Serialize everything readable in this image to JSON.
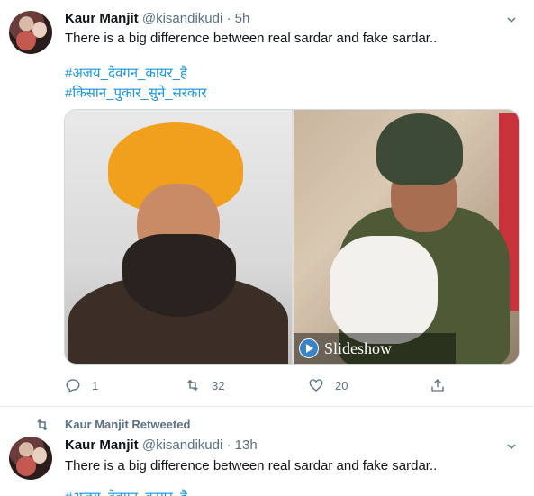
{
  "tweets": [
    {
      "display_name": "Kaur Manjit",
      "handle": "@kisandikudi",
      "separator": "·",
      "time": "5h",
      "text": "There is a big difference between real sardar and fake sardar..",
      "hashtags": [
        "#अजय_देवगन_कायर_है",
        "#किसान_पुकार_सुने_सरकार"
      ],
      "media_overlay_label": "Slideshow",
      "actions": {
        "reply_count": "1",
        "retweet_count": "32",
        "like_count": "20"
      }
    },
    {
      "retweet_header": "Kaur Manjit Retweeted",
      "display_name": "Kaur Manjit",
      "handle": "@kisandikudi",
      "separator": "·",
      "time": "13h",
      "text": "There is a big difference between real sardar and fake sardar..",
      "hashtag_partial": "#अजय_देवगन_कायर_है"
    }
  ],
  "icons": {
    "more": "chevron-down-icon",
    "reply": "reply-icon",
    "retweet": "retweet-icon",
    "like": "heart-icon",
    "share": "share-icon",
    "play": "play-icon"
  },
  "colors": {
    "hashtag": "#1b95e0",
    "secondary_text": "#5b7083",
    "primary_text": "#0f1419",
    "slideshow_play": "#3b83c8"
  }
}
